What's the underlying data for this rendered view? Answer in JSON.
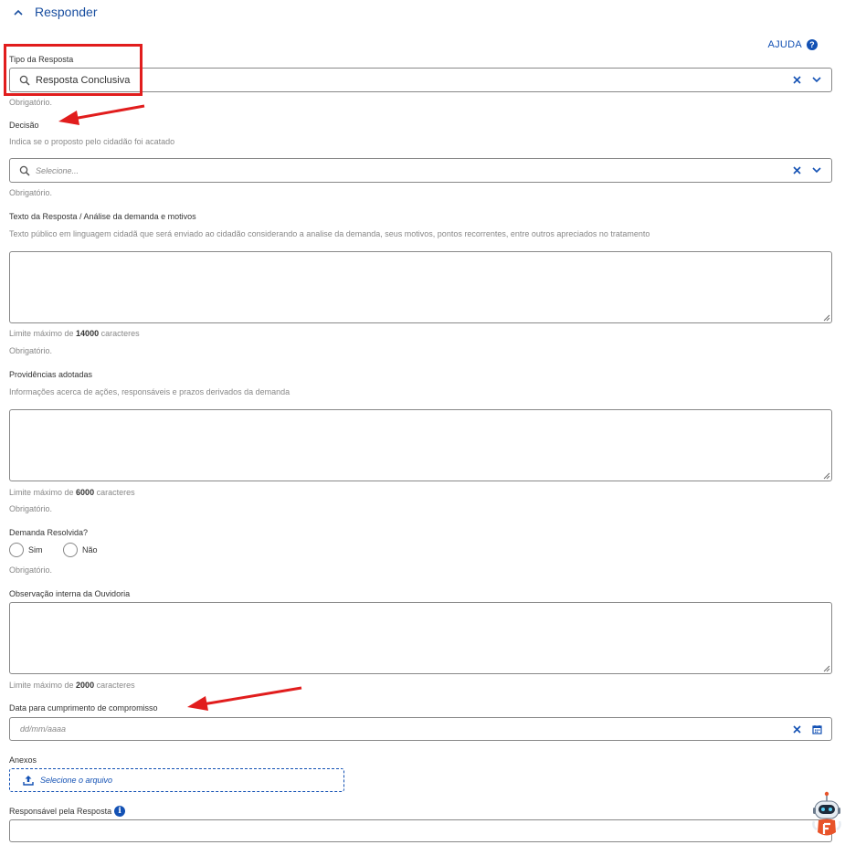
{
  "section": {
    "title": "Responder"
  },
  "help": {
    "label": "AJUDA",
    "icon": "?"
  },
  "tipo_resposta": {
    "label": "Tipo da Resposta",
    "value": "Resposta Conclusiva",
    "required": "Obrigatório."
  },
  "decisao": {
    "label": "Decisão",
    "description": "Indica se o proposto pelo cidadão foi acatado",
    "placeholder": "Selecione...",
    "required": "Obrigatório."
  },
  "texto_resposta": {
    "label": "Texto da Resposta / Análise da demanda e motivos",
    "description": "Texto público em linguagem cidadã que será enviado ao cidadão considerando a analise da demanda, seus motivos, pontos recorrentes, entre outros apreciados no tratamento",
    "limit_prefix": "Limite máximo de",
    "limit_value": "14000",
    "limit_suffix": "caracteres",
    "required": "Obrigatório."
  },
  "providencias": {
    "label": "Providências adotadas",
    "description": "Informações acerca de ações, responsáveis e prazos derivados da demanda",
    "limit_prefix": "Limite máximo de",
    "limit_value": "6000",
    "limit_suffix": "caracteres",
    "required": "Obrigatório."
  },
  "demanda_resolvida": {
    "label": "Demanda Resolvida?",
    "options": [
      "Sim",
      "Não"
    ],
    "required": "Obrigatório."
  },
  "observacao": {
    "label": "Observação interna da Ouvidoria",
    "limit_prefix": "Limite máximo de",
    "limit_value": "2000",
    "limit_suffix": "caracteres"
  },
  "data_cumprimento": {
    "label": "Data para cumprimento de compromisso",
    "placeholder": "dd/mm/aaaa"
  },
  "anexos": {
    "label": "Anexos",
    "button": "Selecione o arquivo"
  },
  "responsavel": {
    "label": "Responsável pela Resposta",
    "info_icon": "i"
  },
  "colors": {
    "accent": "#1351b4",
    "annotation": "#e11d1d",
    "border": "#888888"
  }
}
